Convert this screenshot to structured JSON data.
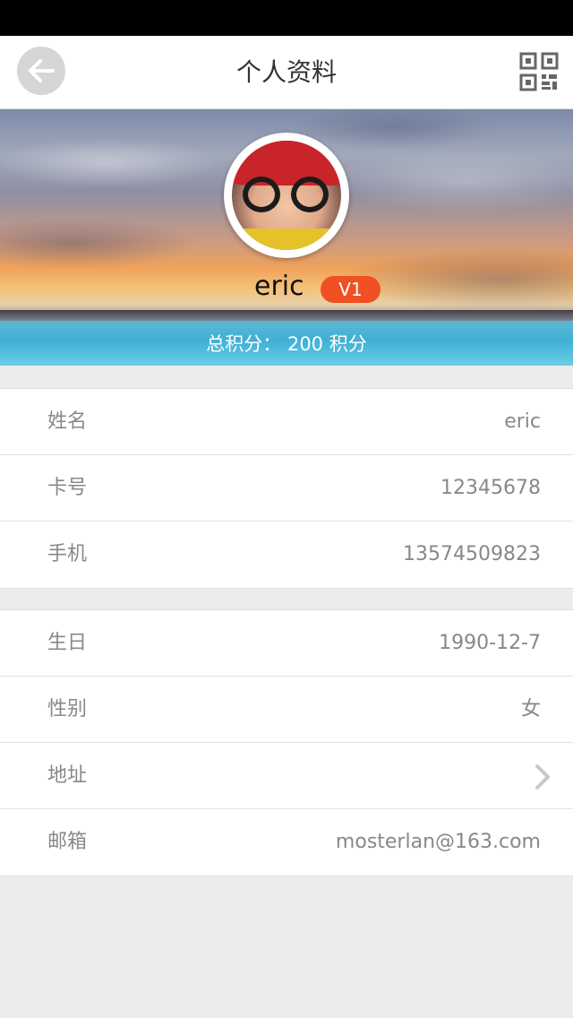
{
  "nav": {
    "title": "个人资料",
    "back_icon": "back-arrow-icon",
    "qr_icon": "qr-code-icon"
  },
  "profile": {
    "name": "eric",
    "level": "V1",
    "points_label": "总积分：  200 积分"
  },
  "colors": {
    "accent": "#f05022",
    "background": "#ececec",
    "label": "#888888"
  },
  "basic_info": [
    {
      "label": "姓名",
      "value": "eric"
    },
    {
      "label": "卡号",
      "value": "12345678"
    },
    {
      "label": "手机",
      "value": "13574509823"
    }
  ],
  "extra_info": [
    {
      "label": "生日",
      "value": "1990-12-7"
    },
    {
      "label": "性别",
      "value": "女"
    },
    {
      "label": "地址",
      "value": ""
    },
    {
      "label": "邮箱",
      "value": "mosterlan@163.com"
    }
  ]
}
